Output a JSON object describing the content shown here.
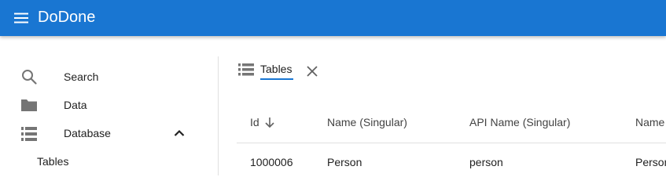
{
  "appbar": {
    "title": "DoDone",
    "menu_icon": "menu-icon",
    "color": "#1976d2"
  },
  "sidebar": {
    "items": [
      {
        "label": "Search",
        "icon": "search-icon"
      },
      {
        "label": "Data",
        "icon": "folder-icon"
      },
      {
        "label": "Database",
        "icon": "database-list-icon",
        "expanded": true,
        "chevron": "chevron-up-icon"
      }
    ],
    "sub_items": [
      {
        "label": "Tables"
      }
    ]
  },
  "tab": {
    "label": "Tables",
    "icon": "table-list-icon",
    "close_icon": "close-icon"
  },
  "table": {
    "columns": [
      "Id",
      "Name (Singular)",
      "API Name (Singular)",
      "Name"
    ],
    "sort": {
      "column": "Id",
      "direction": "descending"
    },
    "rows": [
      {
        "cells": [
          "1000006",
          "Person",
          "person",
          "Person"
        ]
      }
    ]
  }
}
